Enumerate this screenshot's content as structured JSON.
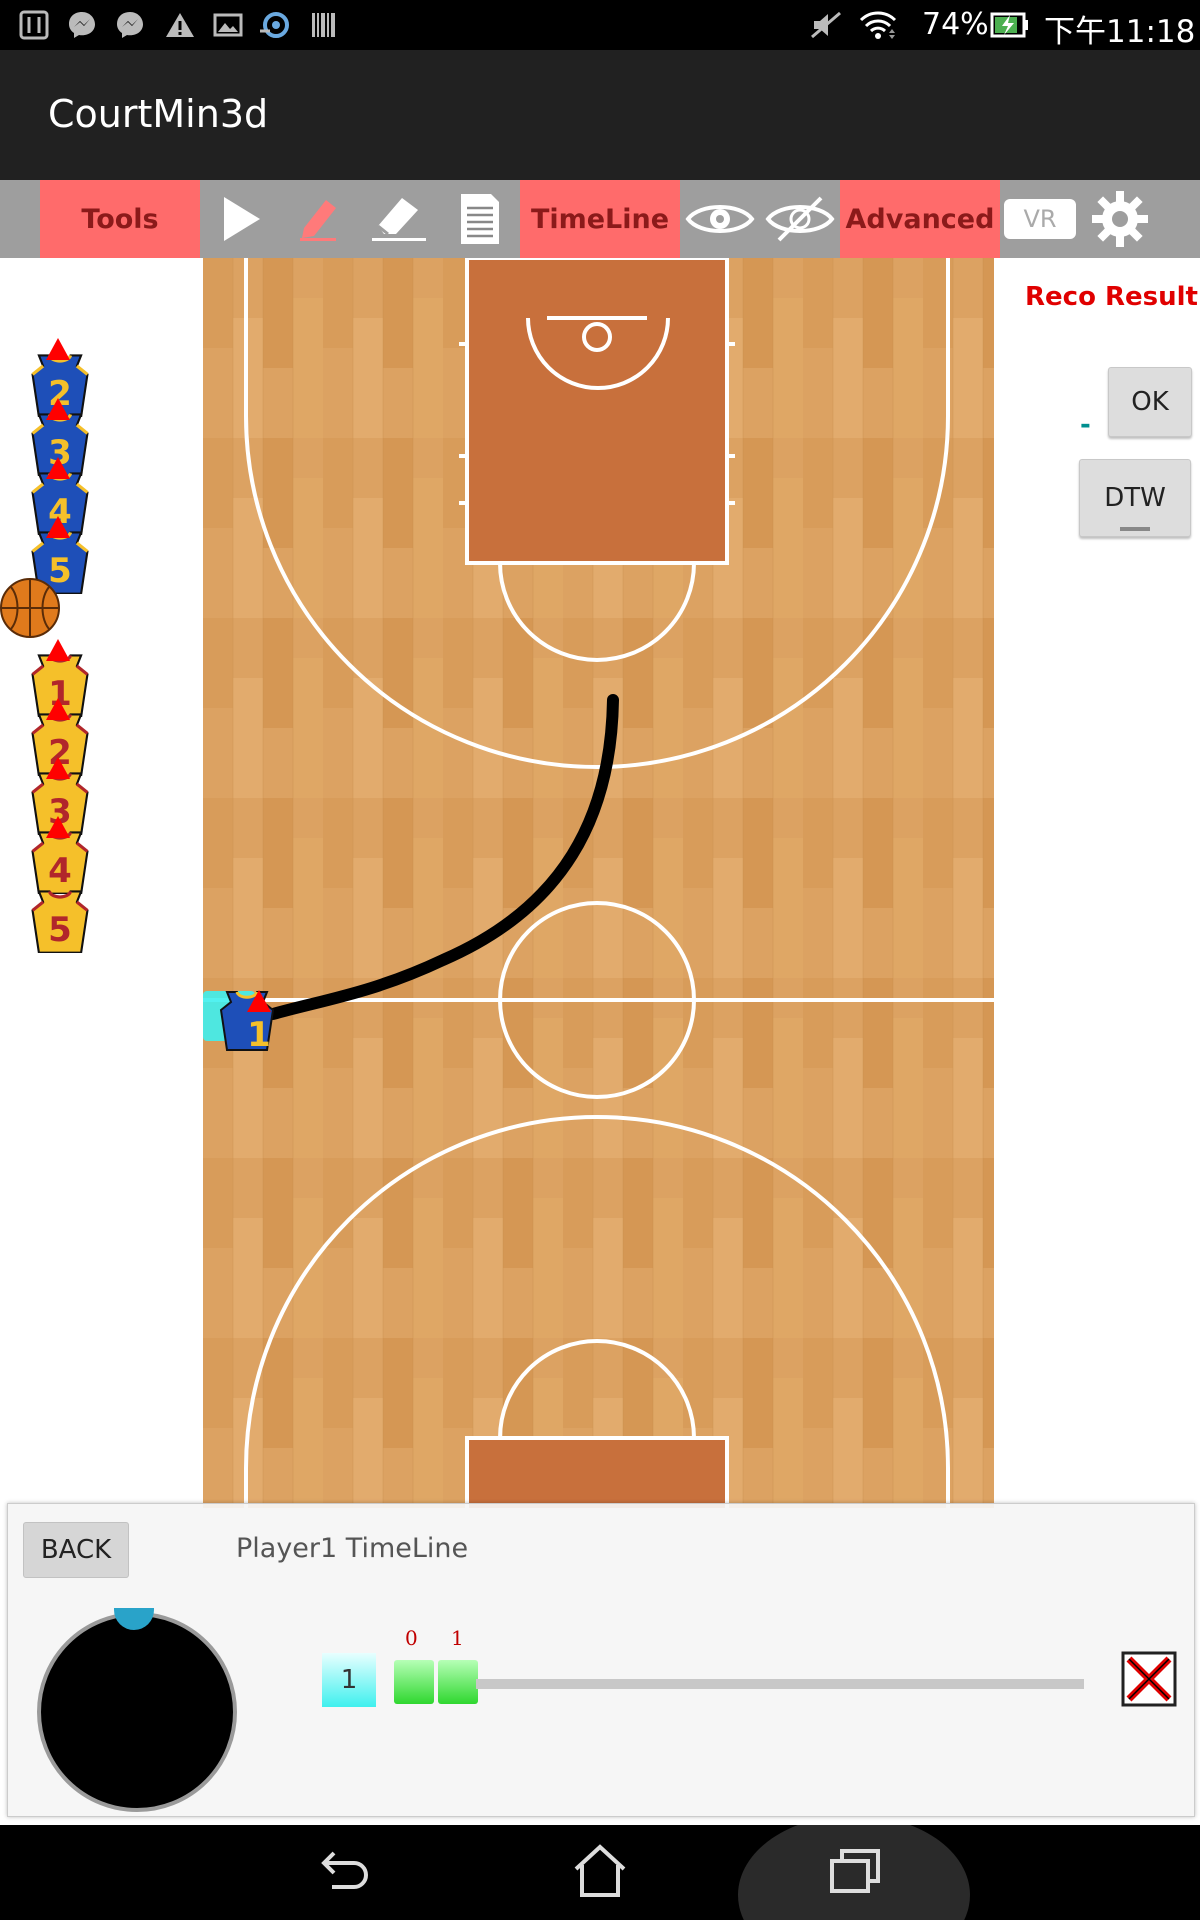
{
  "status_bar": {
    "battery_percent": "74%",
    "time": "下午11:18",
    "left_icons": [
      "settings-icon",
      "messenger-icon",
      "messenger-icon",
      "warning-icon",
      "gallery-icon",
      "weather-icon",
      "barcode-icon"
    ],
    "right_icons": [
      "mute-icon",
      "wifi-icon",
      "battery-charging-icon"
    ]
  },
  "app": {
    "title": "CourtMin3d"
  },
  "toolbar": {
    "tools_label": "Tools",
    "timeline_label": "TimeLine",
    "advanced_label": "Advanced",
    "vr_label": "VR",
    "icons": [
      "play-icon",
      "pen-icon",
      "eraser-icon",
      "document-icon",
      "eye-icon",
      "eye-off-icon",
      "gear-icon"
    ]
  },
  "right_panel": {
    "reco_result_label": "Reco Result",
    "ok_label": "OK",
    "dtw_label": "DTW",
    "value_text": "-"
  },
  "bench": {
    "blue_team": [
      "2",
      "3",
      "4",
      "5"
    ],
    "yellow_team": [
      "1",
      "2",
      "3",
      "4",
      "5"
    ]
  },
  "court_player": {
    "number": "1",
    "chip": "1"
  },
  "timeline": {
    "back_label": "BACK",
    "title": "Player1 TimeLine",
    "player_chip": "1",
    "keyframes": [
      "0",
      "1"
    ]
  },
  "colors": {
    "accent_red": "#ff6b6b",
    "reco_red": "#e00000",
    "court_wood": "#dca262",
    "paint": "#c8703c",
    "blue_jersey": "#1e4fb8",
    "yellow_jersey": "#f5c02a"
  }
}
